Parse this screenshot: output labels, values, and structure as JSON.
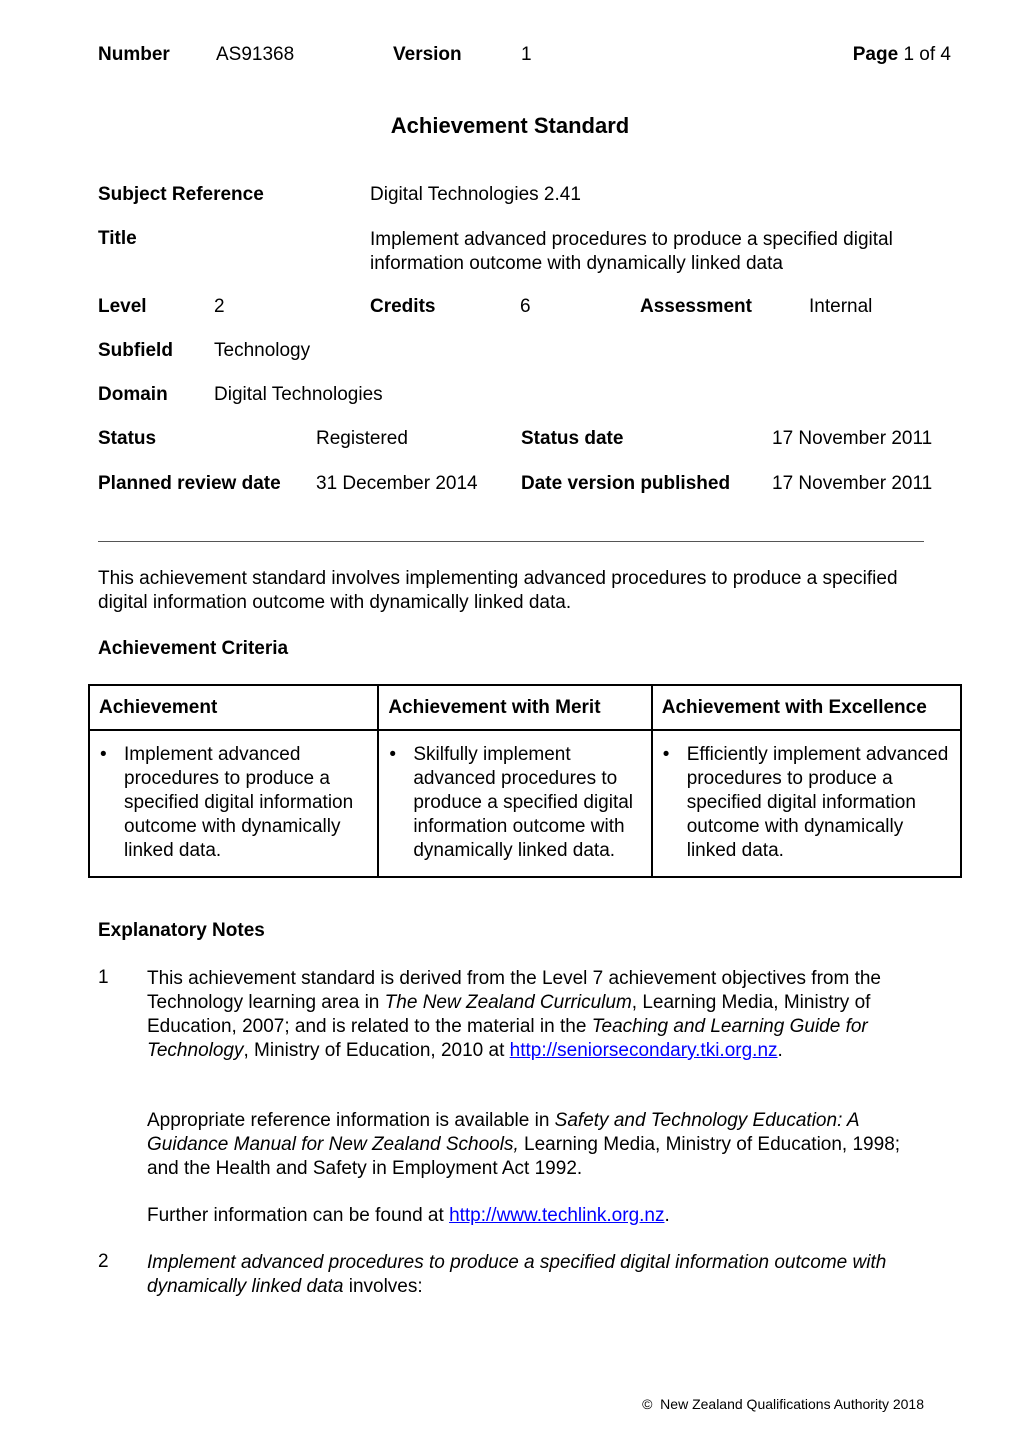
{
  "header": {
    "number_label": "Number",
    "number_value": "AS91368",
    "version_label": "Version",
    "version_value": "1",
    "page_label": "Page",
    "page_value": "1 of 4"
  },
  "doc_title": "Achievement Standard",
  "fields": {
    "subject_reference_label": "Subject Reference",
    "subject_reference_value": "Digital Technologies 2.41",
    "title_label": "Title",
    "title_value": "Implement advanced procedures to produce a specified digital information outcome with dynamically linked data",
    "level_label": "Level",
    "level_value": "2",
    "credits_label": "Credits",
    "credits_value": "6",
    "assessment_label": "Assessment",
    "assessment_value": "Internal",
    "subfield_label": "Subfield",
    "subfield_value": "Technology",
    "domain_label": "Domain",
    "domain_value": "Digital Technologies",
    "status_label": "Status",
    "status_value": "Registered",
    "status_date_label": "Status date",
    "status_date_value": "17 November 2011",
    "planned_review_label": "Planned review date",
    "planned_review_value": "31 December 2014",
    "date_published_label": "Date version published",
    "date_published_value": "17 November 2011"
  },
  "intro": "This achievement standard involves implementing advanced procedures to produce a specified digital information outcome with dynamically linked data.",
  "criteria": {
    "heading": "Achievement Criteria",
    "columns": [
      "Achievement",
      "Achievement with Merit",
      "Achievement with Excellence"
    ],
    "cells": [
      "Implement advanced procedures to produce a specified digital information outcome with dynamically linked data.",
      "Skilfully implement advanced procedures to produce a specified digital information outcome with dynamically linked data.",
      "Efficiently implement advanced procedures to produce a specified digital information outcome with dynamically linked data."
    ]
  },
  "notes": {
    "heading": "Explanatory Notes",
    "note1": {
      "number": "1",
      "p1_a": "This achievement standard is derived from the Level 7 achievement objectives from the Technology learning area in ",
      "p1_i1": "The New Zealand Curriculum",
      "p1_b": ", Learning Media, Ministry of Education, 2007; and is related to the material in the ",
      "p1_i2": "Teaching and Learning Guide for Technology",
      "p1_c": ", Ministry of Education, 2010 at ",
      "p1_link": "http://seniorsecondary.tki.org.nz",
      "p1_d": ".",
      "p2_a": "Appropriate reference information is available in ",
      "p2_i": "Safety and Technology Education: A Guidance Manual for New Zealand Schools,",
      "p2_b": " Learning Media, Ministry of Education, 1998; and the Health and Safety in Employment Act 1992.",
      "p3_a": "Further information can be found at ",
      "p3_link": "http://www.techlink.org.nz",
      "p3_b": "."
    },
    "note2": {
      "number": "2",
      "italic": "Implement advanced procedures to produce a specified digital information outcome with dynamically linked data",
      "rest": " involves:"
    }
  },
  "footer": {
    "copyright_symbol": "©",
    "text": "New Zealand Qualifications Authority 2018"
  }
}
